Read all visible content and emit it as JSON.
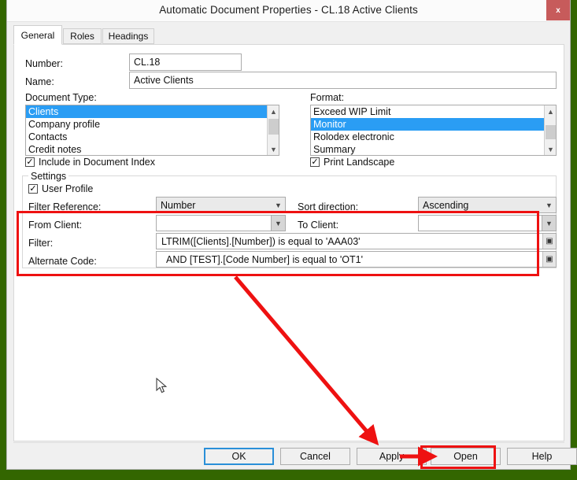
{
  "window": {
    "title": "Automatic Document Properties - CL.18 Active Clients",
    "close_label": "x",
    "close_icon": "close-icon",
    "border_color": "#336600"
  },
  "tabs": [
    {
      "label": "General",
      "active": true
    },
    {
      "label": "Roles",
      "active": false
    },
    {
      "label": "Headings",
      "active": false
    }
  ],
  "form": {
    "number_label": "Number:",
    "number_value": "CL.18",
    "name_label": "Name:",
    "name_value": "Active Clients",
    "document_type_label": "Document Type:",
    "document_type_items": [
      "Clients",
      "Company profile",
      "Contacts",
      "Credit notes"
    ],
    "document_type_selected": "Clients",
    "format_label": "Format:",
    "format_items": [
      "Exceed WIP Limit",
      "Monitor",
      "Rolodex electronic",
      "Summary"
    ],
    "format_selected": "Monitor",
    "include_index_label": "Include in Document Index",
    "include_index_checked": true,
    "print_landscape_label": "Print Landscape",
    "print_landscape_checked": true
  },
  "settings": {
    "group_title": "Settings",
    "user_profile_label": "User Profile",
    "user_profile_checked": true,
    "filter_reference_label": "Filter Reference:",
    "filter_reference_value": "Number",
    "sort_direction_label": "Sort direction:",
    "sort_direction_value": "Ascending",
    "from_client_label": "From Client:",
    "from_client_value": "",
    "to_client_label": "To Client:",
    "to_client_value": "",
    "filter_label": "Filter:",
    "filter_value": "LTRIM([Clients].[Number]) is equal to 'AAA03'",
    "alternate_code_label": "Alternate Code:",
    "alternate_code_value": "AND [TEST].[Code Number] is equal to 'OT1'",
    "builder_icon": "expression-builder-icon"
  },
  "footer": {
    "buttons": [
      {
        "label": "OK",
        "default": true
      },
      {
        "label": "Cancel",
        "default": false
      },
      {
        "label": "Apply",
        "default": false
      },
      {
        "label": "Open",
        "default": false
      },
      {
        "label": "Help",
        "default": false
      }
    ]
  },
  "annotations": {
    "highlight_color": "#ee1111",
    "cursor_icon": "mouse-pointer-icon"
  }
}
